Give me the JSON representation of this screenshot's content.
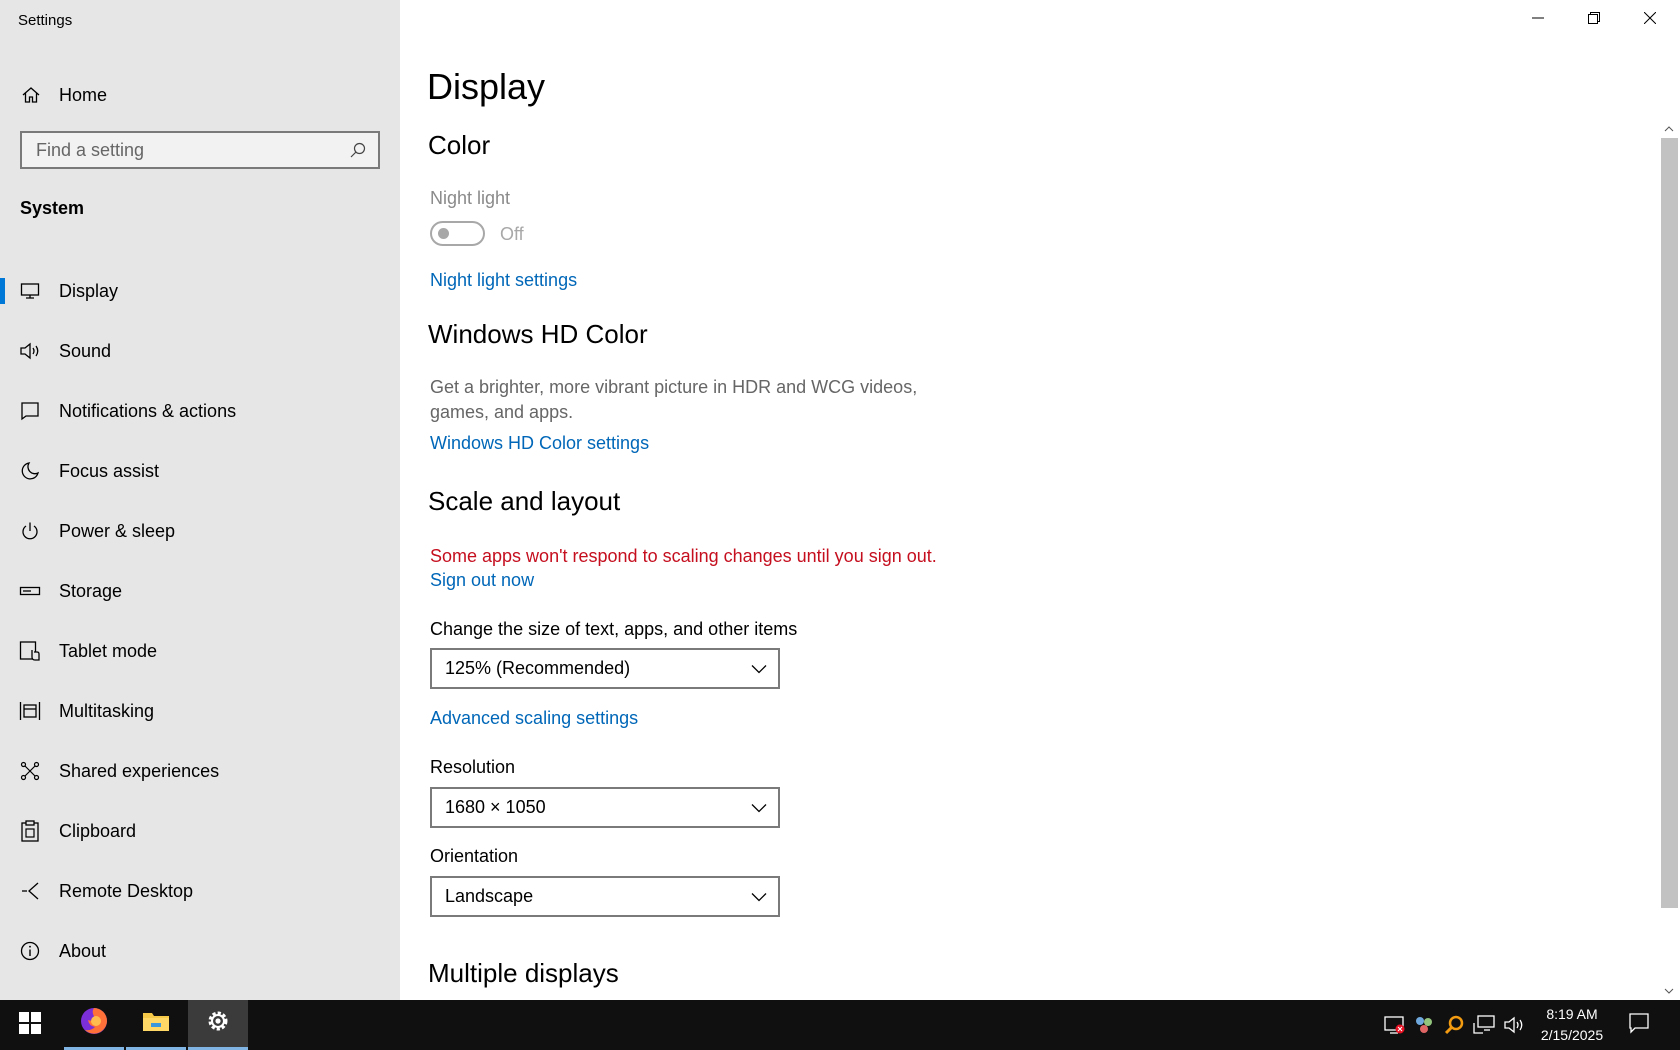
{
  "window": {
    "title": "Settings",
    "controls": {
      "minimize": "minimize-icon",
      "restore": "restore-icon",
      "close": "close-icon"
    }
  },
  "sidebar": {
    "home_label": "Home",
    "search": {
      "placeholder": "Find a setting",
      "value": ""
    },
    "section": "System",
    "items": [
      {
        "label": "Display",
        "icon": "monitor-icon",
        "active": true
      },
      {
        "label": "Sound",
        "icon": "speaker-icon"
      },
      {
        "label": "Notifications & actions",
        "icon": "notification-icon"
      },
      {
        "label": "Focus assist",
        "icon": "moon-icon"
      },
      {
        "label": "Power & sleep",
        "icon": "power-icon"
      },
      {
        "label": "Storage",
        "icon": "storage-icon"
      },
      {
        "label": "Tablet mode",
        "icon": "tablet-icon"
      },
      {
        "label": "Multitasking",
        "icon": "multitasking-icon"
      },
      {
        "label": "Shared experiences",
        "icon": "share-icon"
      },
      {
        "label": "Clipboard",
        "icon": "clipboard-icon"
      },
      {
        "label": "Remote Desktop",
        "icon": "remote-desktop-icon"
      },
      {
        "label": "About",
        "icon": "info-icon"
      }
    ]
  },
  "main": {
    "title": "Display",
    "color": {
      "heading": "Color",
      "night_light_label": "Night light",
      "night_light_state": "Off",
      "night_light_link": "Night light settings"
    },
    "hd_color": {
      "heading": "Windows HD Color",
      "description": "Get a brighter, more vibrant picture in HDR and WCG videos, games, and apps.",
      "link": "Windows HD Color settings"
    },
    "scale_layout": {
      "heading": "Scale and layout",
      "warning": "Some apps won't respond to scaling changes until you sign out.",
      "sign_out_link": "Sign out now",
      "scale_label": "Change the size of text, apps, and other items",
      "scale_value": "125% (Recommended)",
      "advanced_link": "Advanced scaling settings",
      "resolution_label": "Resolution",
      "resolution_value": "1680 × 1050",
      "orientation_label": "Orientation",
      "orientation_value": "Landscape"
    },
    "multiple_displays": {
      "heading": "Multiple displays"
    }
  },
  "taskbar": {
    "apps": [
      "start-icon",
      "firefox-icon",
      "file-explorer-icon",
      "settings-icon"
    ],
    "clock": {
      "time": "8:19 AM",
      "date": "2/15/2025"
    }
  },
  "colors": {
    "accent": "#0078d7",
    "link": "#0067b8",
    "warning": "#c50f1f",
    "sidebar_bg": "#e6e6e6",
    "taskbar_bg": "#101010"
  }
}
